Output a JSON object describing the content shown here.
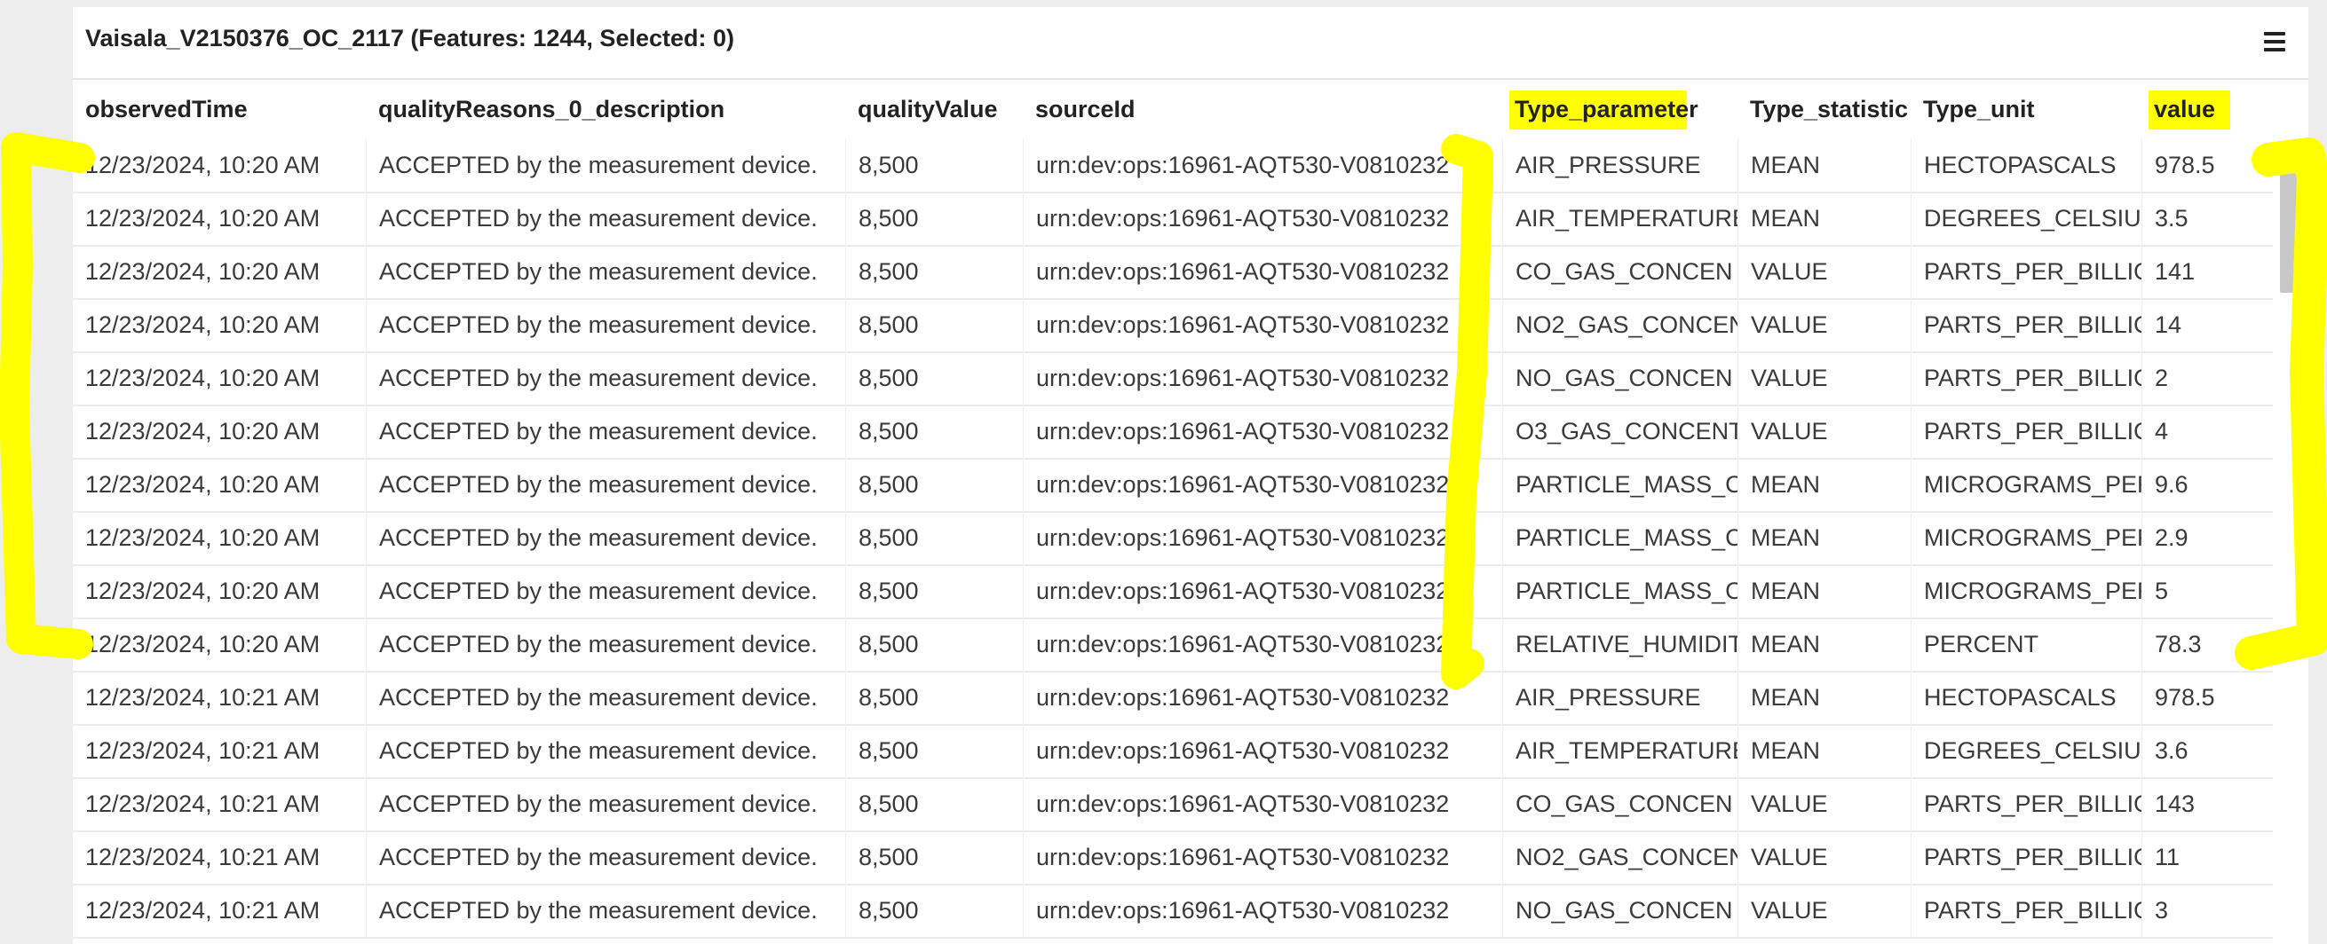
{
  "panel": {
    "title": "Vaisala_V2150376_OC_2117 (Features: 1244, Selected: 0)",
    "menu_icon": "hamburger-menu-icon"
  },
  "table": {
    "columns": [
      "observedTime",
      "qualityReasons_0_description",
      "qualityValue",
      "sourceId",
      "Type_parameter",
      "Type_statistic",
      "Type_unit",
      "value"
    ],
    "highlighted_columns": [
      "Type_parameter",
      "value"
    ],
    "rows": [
      [
        "12/23/2024, 10:20 AM",
        "ACCEPTED by the measurement device.",
        "8,500",
        "urn:dev:ops:16961-AQT530-V0810232",
        "AIR_PRESSURE",
        "MEAN",
        "HECTOPASCALS",
        "978.5"
      ],
      [
        "12/23/2024, 10:20 AM",
        "ACCEPTED by the measurement device.",
        "8,500",
        "urn:dev:ops:16961-AQT530-V0810232",
        "AIR_TEMPERATURE",
        "MEAN",
        "DEGREES_CELSIUS",
        "3.5"
      ],
      [
        "12/23/2024, 10:20 AM",
        "ACCEPTED by the measurement device.",
        "8,500",
        "urn:dev:ops:16961-AQT530-V0810232",
        "CO_GAS_CONCEN",
        "VALUE",
        "PARTS_PER_BILLION",
        "141"
      ],
      [
        "12/23/2024, 10:20 AM",
        "ACCEPTED by the measurement device.",
        "8,500",
        "urn:dev:ops:16961-AQT530-V0810232",
        "NO2_GAS_CONCEN",
        "VALUE",
        "PARTS_PER_BILLION",
        "14"
      ],
      [
        "12/23/2024, 10:20 AM",
        "ACCEPTED by the measurement device.",
        "8,500",
        "urn:dev:ops:16961-AQT530-V0810232",
        "NO_GAS_CONCEN",
        "VALUE",
        "PARTS_PER_BILLION",
        "2"
      ],
      [
        "12/23/2024, 10:20 AM",
        "ACCEPTED by the measurement device.",
        "8,500",
        "urn:dev:ops:16961-AQT530-V0810232",
        "O3_GAS_CONCENT",
        "VALUE",
        "PARTS_PER_BILLION",
        "4"
      ],
      [
        "12/23/2024, 10:20 AM",
        "ACCEPTED by the measurement device.",
        "8,500",
        "urn:dev:ops:16961-AQT530-V0810232",
        "PARTICLE_MASS_CO",
        "MEAN",
        "MICROGRAMS_PER",
        "9.6"
      ],
      [
        "12/23/2024, 10:20 AM",
        "ACCEPTED by the measurement device.",
        "8,500",
        "urn:dev:ops:16961-AQT530-V0810232",
        "PARTICLE_MASS_CO",
        "MEAN",
        "MICROGRAMS_PER",
        "2.9"
      ],
      [
        "12/23/2024, 10:20 AM",
        "ACCEPTED by the measurement device.",
        "8,500",
        "urn:dev:ops:16961-AQT530-V0810232",
        "PARTICLE_MASS_CO",
        "MEAN",
        "MICROGRAMS_PER",
        "5"
      ],
      [
        "12/23/2024, 10:20 AM",
        "ACCEPTED by the measurement device.",
        "8,500",
        "urn:dev:ops:16961-AQT530-V0810232",
        "RELATIVE_HUMIDITY",
        "MEAN",
        "PERCENT",
        "78.3"
      ],
      [
        "12/23/2024, 10:21 AM",
        "ACCEPTED by the measurement device.",
        "8,500",
        "urn:dev:ops:16961-AQT530-V0810232",
        "AIR_PRESSURE",
        "MEAN",
        "HECTOPASCALS",
        "978.5"
      ],
      [
        "12/23/2024, 10:21 AM",
        "ACCEPTED by the measurement device.",
        "8,500",
        "urn:dev:ops:16961-AQT530-V0810232",
        "AIR_TEMPERATURE",
        "MEAN",
        "DEGREES_CELSIUS",
        "3.6"
      ],
      [
        "12/23/2024, 10:21 AM",
        "ACCEPTED by the measurement device.",
        "8,500",
        "urn:dev:ops:16961-AQT530-V0810232",
        "CO_GAS_CONCEN",
        "VALUE",
        "PARTS_PER_BILLION",
        "143"
      ],
      [
        "12/23/2024, 10:21 AM",
        "ACCEPTED by the measurement device.",
        "8,500",
        "urn:dev:ops:16961-AQT530-V0810232",
        "NO2_GAS_CONCEN",
        "VALUE",
        "PARTS_PER_BILLION",
        "11"
      ],
      [
        "12/23/2024, 10:21 AM",
        "ACCEPTED by the measurement device.",
        "8,500",
        "urn:dev:ops:16961-AQT530-V0810232",
        "NO_GAS_CONCEN",
        "VALUE",
        "PARTS_PER_BILLION",
        "3"
      ]
    ]
  },
  "colors": {
    "highlight": "#ffff00",
    "panel_bg": "#ffffff",
    "page_bg": "#ededed",
    "text": "#3a3a3a"
  },
  "annotations": {
    "type": "yellow-brackets",
    "description_hidden": true
  }
}
